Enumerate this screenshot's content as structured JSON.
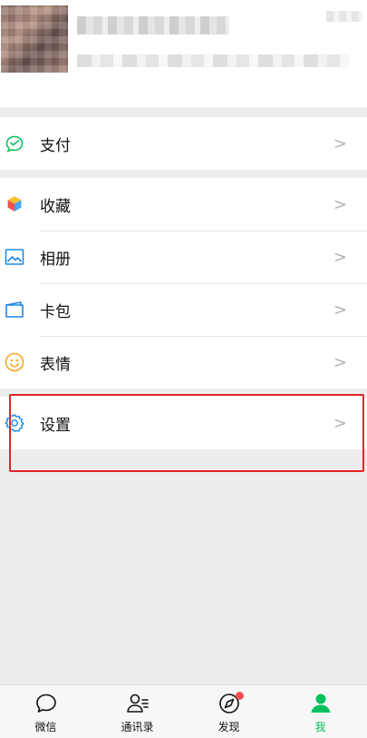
{
  "menu": {
    "pay": "支付",
    "favorites": "收藏",
    "album": "相册",
    "cards": "卡包",
    "stickers": "表情",
    "settings": "设置"
  },
  "tabs": [
    {
      "label": "微信"
    },
    {
      "label": "通讯录"
    },
    {
      "label": "发现"
    },
    {
      "label": "我"
    }
  ],
  "colors": {
    "accent": "#07c160",
    "highlight": "#e5242b",
    "badge": "#fa5151",
    "background": "#ededed"
  }
}
